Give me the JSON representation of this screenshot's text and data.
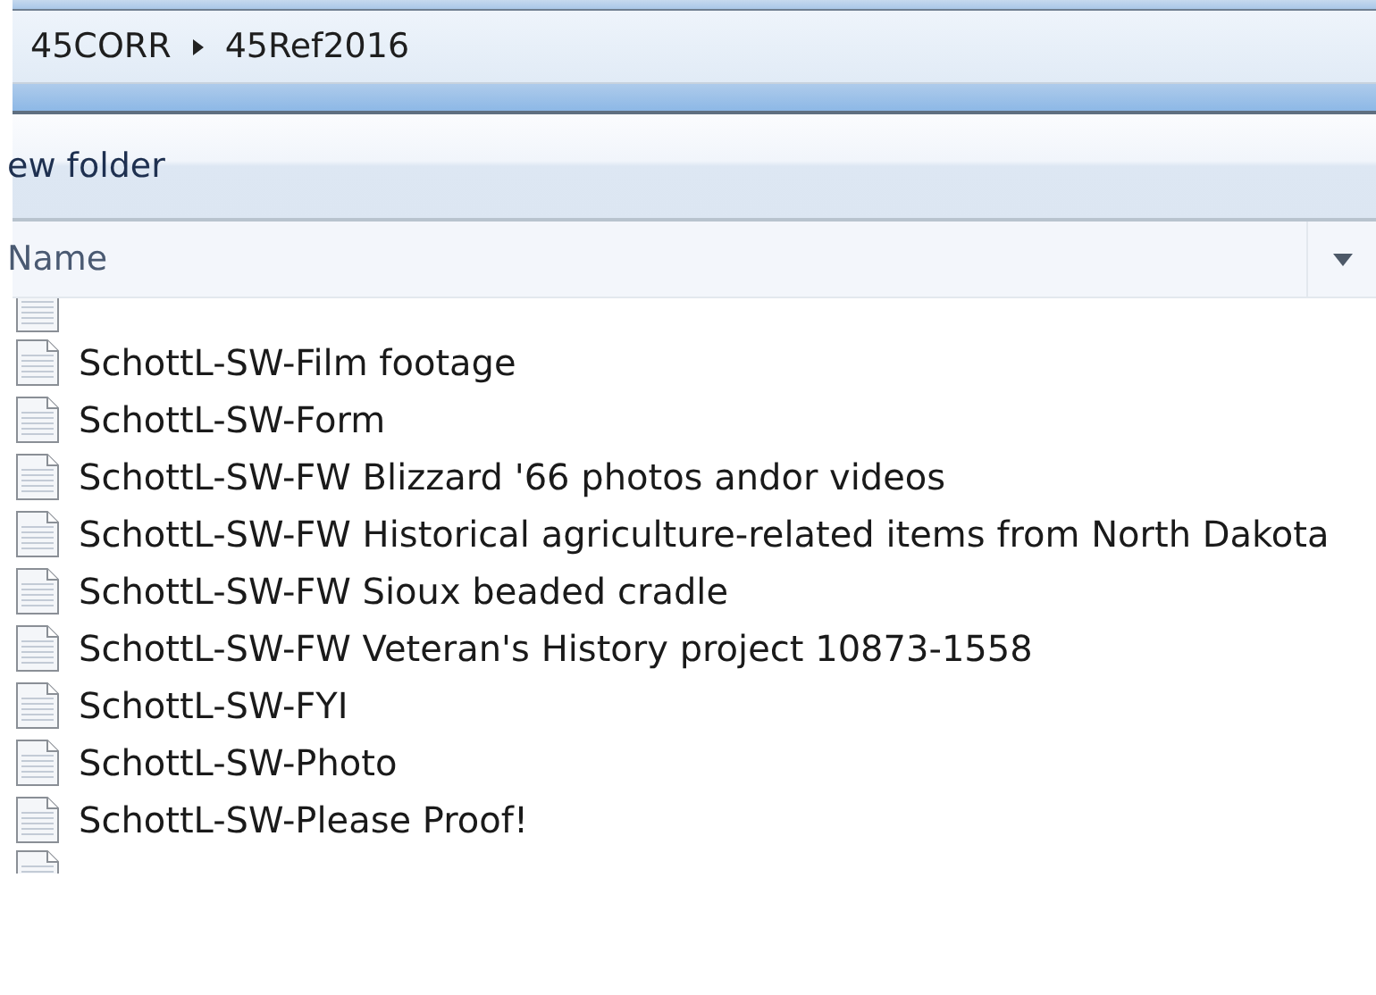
{
  "breadcrumb": [
    {
      "label": "45CORR"
    },
    {
      "label": "45Ref2016"
    }
  ],
  "toolbar": {
    "new_folder": "ew folder"
  },
  "columns": [
    {
      "label": "Name"
    }
  ],
  "files": [
    {
      "name": "SchottL-SW-Film footage"
    },
    {
      "name": "SchottL-SW-Form"
    },
    {
      "name": "SchottL-SW-FW Blizzard '66 photos andor videos"
    },
    {
      "name": "SchottL-SW-FW Historical agriculture-related items from North Dakota"
    },
    {
      "name": "SchottL-SW-FW Sioux beaded cradle"
    },
    {
      "name": "SchottL-SW-FW Veteran's History project 10873-1558"
    },
    {
      "name": "SchottL-SW-FYI"
    },
    {
      "name": "SchottL-SW-Photo"
    },
    {
      "name": "SchottL-SW-Please Proof!"
    }
  ]
}
